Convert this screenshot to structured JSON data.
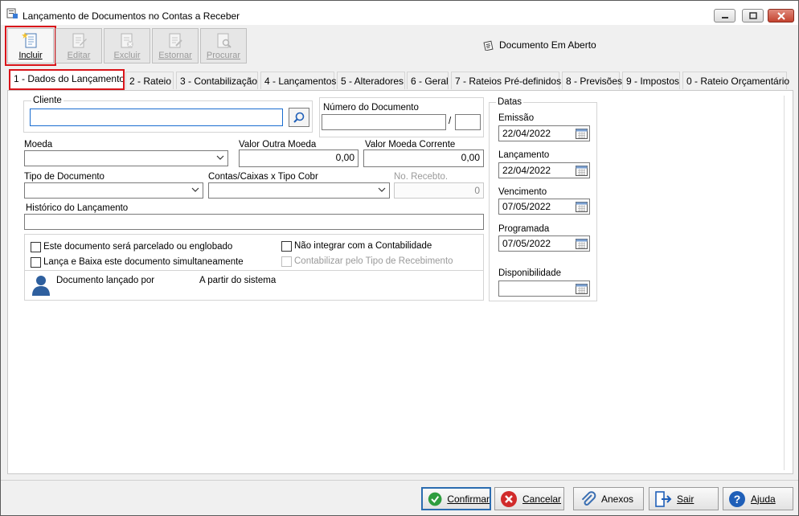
{
  "window": {
    "title": "Lançamento de Documentos no Contas a Receber"
  },
  "toolbar": {
    "buttons": [
      {
        "label": "Incluir",
        "icon": "new-document-icon",
        "enabled": true
      },
      {
        "label": "Editar",
        "icon": "edit-document-icon",
        "enabled": false
      },
      {
        "label": "Excluir",
        "icon": "delete-document-icon",
        "enabled": false
      },
      {
        "label": "Estornar",
        "icon": "reverse-document-icon",
        "enabled": false
      },
      {
        "label": "Procurar",
        "icon": "search-document-icon",
        "enabled": false
      }
    ],
    "status": "Documento Em Aberto"
  },
  "tabs": [
    "1 - Dados do Lançamento",
    "2 - Rateio",
    "3 - Contabilização",
    "4 - Lançamentos",
    "5 - Alteradores",
    "6 - Geral",
    "7 - Rateios Pré-definidos",
    "8 - Previsões",
    "9 - Impostos",
    "0 - Rateio Orçamentário"
  ],
  "form": {
    "cliente": {
      "label": "Cliente",
      "value": ""
    },
    "numero_documento": {
      "label": "Número do Documento",
      "value": "",
      "separator": "/",
      "suffix": ""
    },
    "moeda": {
      "label": "Moeda",
      "value": ""
    },
    "valor_outra_moeda": {
      "label": "Valor Outra Moeda",
      "value": "0,00"
    },
    "valor_moeda_corrente": {
      "label": "Valor Moeda Corrente",
      "value": "0,00"
    },
    "tipo_documento": {
      "label": "Tipo de Documento",
      "value": ""
    },
    "contas_caixas": {
      "label": "Contas/Caixas x Tipo Cobr",
      "value": ""
    },
    "no_recebto": {
      "label": "No. Recebto.",
      "value": "0"
    },
    "historico": {
      "label": "Histórico do Lançamento",
      "value": ""
    },
    "checks": {
      "parcelado": "Este documento será parcelado ou englobado",
      "lanca_baixa": "Lança e Baixa este documento simultaneamente",
      "nao_integrar": "Não integrar com a Contabilidade",
      "contabilizar": "Contabilizar pelo Tipo de Recebimento"
    },
    "lancado_por": {
      "label": "Documento lançado por",
      "origin": "A partir do sistema"
    }
  },
  "datas": {
    "title": "Datas",
    "emissao": {
      "label": "Emissão",
      "value": "22/04/2022"
    },
    "lancamento": {
      "label": "Lançamento",
      "value": "22/04/2022"
    },
    "vencimento": {
      "label": "Vencimento",
      "value": "07/05/2022"
    },
    "programada": {
      "label": "Programada",
      "value": "07/05/2022"
    },
    "disponibilidade": {
      "label": "Disponibilidade",
      "value": ""
    }
  },
  "footer": {
    "confirmar": "Confirmar",
    "cancelar": "Cancelar",
    "anexos": "Anexos",
    "sair": "Sair",
    "ajuda": "Ajuda"
  },
  "colors": {
    "highlight_red": "#d9141a",
    "focus_blue": "#1a6dd0",
    "confirm_green": "#2e9d3f",
    "cancel_red": "#d12b2b",
    "help_blue": "#1f5fb8"
  }
}
